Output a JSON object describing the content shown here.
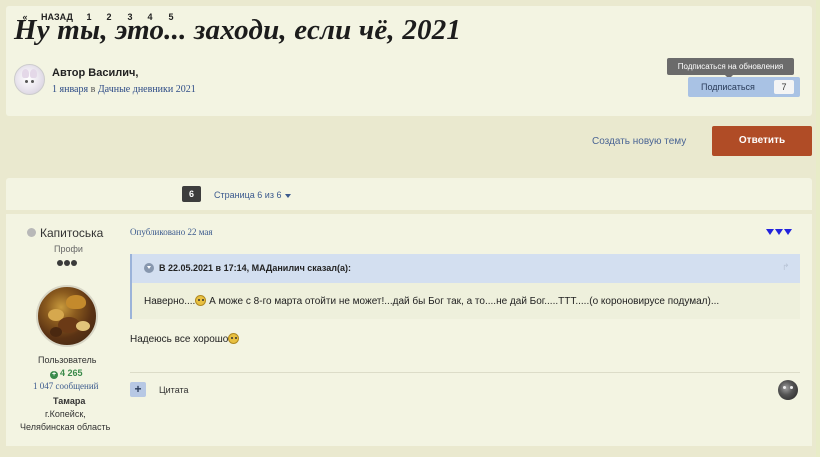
{
  "topic": {
    "title": "Ну ты, это... заходи, если чё, 2021",
    "author_line": "Автор Василич,",
    "date": "1 января",
    "in_word": "в",
    "forum": "Дачные дневники 2021"
  },
  "follow": {
    "tooltip": "Подписаться на обновления",
    "label": "Подписаться",
    "count": "7"
  },
  "actions": {
    "new_topic": "Создать новую тему",
    "reply": "Ответить"
  },
  "pagination": {
    "first": "«",
    "back": "НАЗАД",
    "pages": [
      "1",
      "2",
      "3",
      "4",
      "5",
      "6"
    ],
    "current": "6",
    "info": "Страница 6 из 6"
  },
  "post": {
    "author": "Капитоська",
    "rank": "Профи",
    "group": "Пользователь",
    "reputation": "4 265",
    "posts": "1 047 сообщений",
    "name": "Тамара",
    "city": "г.Копейск,",
    "region": "Челябинская область",
    "date": "Опубликовано 22 мая",
    "quote_cite": "В 22.05.2021 в 17:14, МАДанилич сказал(а):",
    "quote_text_1": "Наверно....",
    "quote_text_2": " А може с 8-го марта отойти не может!...дай бы Бог так, а то....не дай Бог.....ТТТ.....(о короновирусе подумал)...",
    "body": "Надеюсь все хорошо",
    "quote_button": "Цитата",
    "quote_add": "+"
  },
  "colors": {
    "background": "#eae9cf",
    "card": "#f3f4e2",
    "reply_button": "#b04c26",
    "follow_button": "#a9c2e4",
    "link": "#3b5a8e",
    "reputation": "#3a8a4a"
  }
}
